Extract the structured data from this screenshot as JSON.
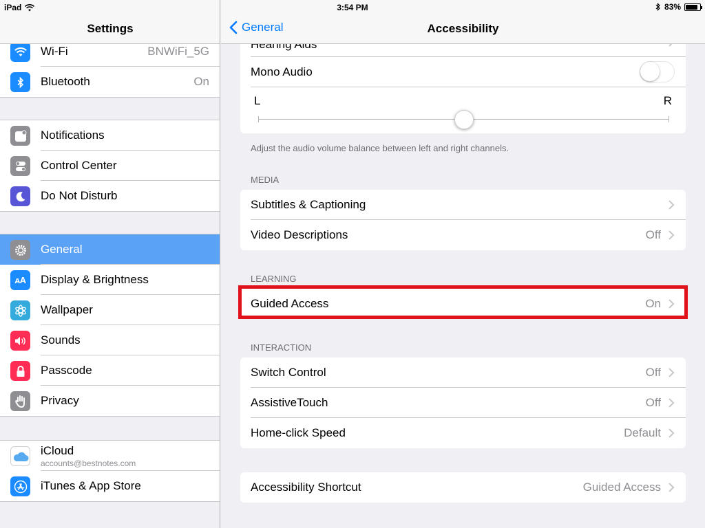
{
  "status_bar": {
    "device": "iPad",
    "time": "3:54 PM",
    "battery": "83%",
    "battery_level": 0.83
  },
  "left_pane": {
    "title": "Settings",
    "groups": [
      [
        {
          "label": "Wi-Fi",
          "value": "BNWiFi_5G",
          "icon": "wifi-icon",
          "color": "#1a8cff"
        },
        {
          "label": "Bluetooth",
          "value": "On",
          "icon": "bluetooth-icon",
          "color": "#1a8cff"
        }
      ],
      [
        {
          "label": "Notifications",
          "icon": "notifications-icon",
          "color": "#8e8e93"
        },
        {
          "label": "Control Center",
          "icon": "control-center-icon",
          "color": "#8e8e93"
        },
        {
          "label": "Do Not Disturb",
          "icon": "moon-icon",
          "color": "#5856d6"
        }
      ],
      [
        {
          "label": "General",
          "icon": "gear-icon",
          "color": "#8e8e93",
          "selected": true
        },
        {
          "label": "Display & Brightness",
          "icon": "display-brightness-icon",
          "color": "#1a8cff"
        },
        {
          "label": "Wallpaper",
          "icon": "wallpaper-icon",
          "color": "#35aadc"
        },
        {
          "label": "Sounds",
          "icon": "speaker-icon",
          "color": "#ff2d55"
        },
        {
          "label": "Passcode",
          "icon": "lock-icon",
          "color": "#ff2d55"
        },
        {
          "label": "Privacy",
          "icon": "hand-icon",
          "color": "#8e8e93"
        }
      ],
      [
        {
          "label": "iCloud",
          "sub": "accounts@bestnotes.com",
          "icon": "icloud-icon",
          "color": "#ffffff"
        },
        {
          "label": "iTunes & App Store",
          "icon": "app-store-icon",
          "color": "#1a8cff"
        }
      ]
    ]
  },
  "right_pane": {
    "back_label": "General",
    "title": "Accessibility",
    "partial_row": "Hearing Aids",
    "mono_audio": {
      "label": "Mono Audio",
      "on": false
    },
    "balance": {
      "left": "L",
      "right": "R",
      "level": 0.5,
      "footer": "Adjust the audio volume balance between left and right channels."
    },
    "sections": {
      "media": {
        "header": "MEDIA",
        "rows": [
          {
            "label": "Subtitles & Captioning",
            "value": ""
          },
          {
            "label": "Video Descriptions",
            "value": "Off"
          }
        ]
      },
      "learning": {
        "header": "LEARNING",
        "rows": [
          {
            "label": "Guided Access",
            "value": "On"
          }
        ]
      },
      "interaction": {
        "header": "INTERACTION",
        "rows": [
          {
            "label": "Switch Control",
            "value": "Off"
          },
          {
            "label": "AssistiveTouch",
            "value": "Off"
          },
          {
            "label": "Home-click Speed",
            "value": "Default"
          }
        ]
      },
      "shortcut": {
        "rows": [
          {
            "label": "Accessibility Shortcut",
            "value": "Guided Access"
          }
        ]
      }
    }
  }
}
